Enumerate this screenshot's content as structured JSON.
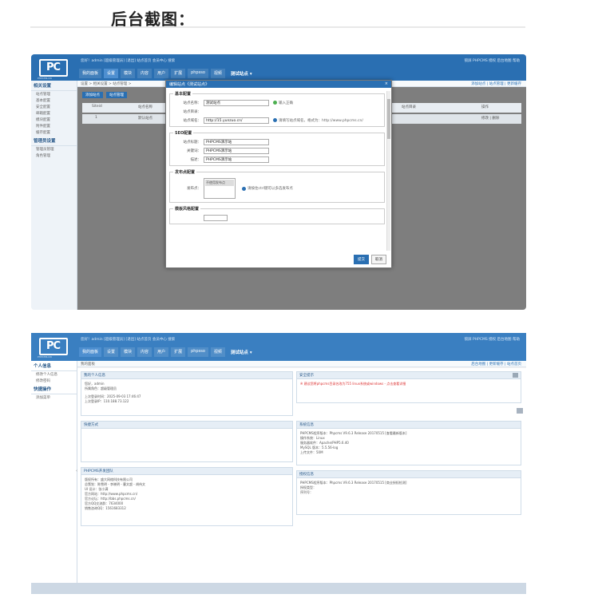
{
  "heading": "后台截图：",
  "shot1": {
    "logo": "PC",
    "logo_sub": "PHPCMS.CN",
    "userbar": "您好！admin [超级管理员] [退出] 站点首页 会员中心 搜索",
    "rlinks": "锁屏 PHPCMS 授权 后台地图 帮助",
    "nav": [
      "我的面板",
      "设置",
      "模块",
      "内容",
      "用户",
      "扩展",
      "phpsso",
      "视频",
      "测试站点 ▾"
    ],
    "sidebar": {
      "group1": "相关设置",
      "items1": [
        "站点管理",
        "基本配置",
        "安全配置",
        "邮箱配置",
        "模块配置",
        "附件配置",
        "缓存配置"
      ],
      "group2": "管理员设置",
      "items2": [
        "管理员管理",
        "角色管理"
      ]
    },
    "crumb": "设置 > 相关设置 > 站点管理 >",
    "crumb_right": "添加站点 | 站点管理 | 更新缓存",
    "buttons": [
      "添加站点",
      "站点管理"
    ],
    "table_cols": [
      "Siteid",
      "站点名称",
      "站点目录",
      "操作"
    ],
    "table_row": [
      "1",
      "默认站点",
      "",
      "修改 | 删除"
    ],
    "modal": {
      "title": "编辑站点《测试站点》",
      "close": "×",
      "basic_legend": "基本配置",
      "site_name_label": "站点名称：",
      "site_name_value": "测试站点",
      "site_name_tip": "输入正确",
      "site_dir_label": "站点目录：",
      "site_domain_label": "站点域名：",
      "site_domain_value": "http://15.yunzuo.cn/",
      "site_domain_tip": "请填写站点域名，格式为：http://www.phpcms.cn/",
      "seo_legend": "SEO配置",
      "seo_title_label": "站点标题：",
      "seo_title_value": "PHPCMS演示站",
      "seo_kw_label": "关键词：",
      "seo_kw_value": "PHPCMS演示站",
      "seo_desc_label": "描述：",
      "seo_desc_value": "PHPCMS演示站",
      "release_legend": "发布点配置",
      "release_label": "发布点：",
      "release_option": "不使用发布点",
      "release_tip": "请按住ctrl键可以多选发布点",
      "template_legend": "模板风格配置",
      "ok": "提交",
      "cancel": "取消"
    }
  },
  "shot2": {
    "logo": "PC",
    "logo_sub": "PHPCMS.CN",
    "userbar": "您好！admin [超级管理员] [退出] 站点首页 会员中心 搜索",
    "rlinks": "锁屏 PHPCMS 授权 后台地图 帮助",
    "nav": [
      "我的面板",
      "设置",
      "模块",
      "内容",
      "用户",
      "扩展",
      "phpsso",
      "视频",
      "测试站点 ▾"
    ],
    "sidebar": {
      "group1": "个人信息",
      "items1": [
        "修改个人信息",
        "修改密码"
      ],
      "group2": "快捷操作",
      "items2": [
        "添加菜单"
      ]
    },
    "crumb": "我的面板",
    "crumb_right": "后台地图 | 更新缓存 | 站点首页",
    "panels": {
      "personal_title": "我的个人信息",
      "personal_lines": [
        "您好，admin",
        "所属角色：超级管理员",
        "上次登录时间：2025-09-03 17:46:47",
        "上次登录IP：110.188.73.122"
      ],
      "security_title": "安全提示",
      "security_line": "※ 建议您将phpcms目录名改为755 linux系统或windows - 点击查看详细",
      "shortcut_title": "快捷方式",
      "sysinfo_title": "系统信息",
      "sysinfo_lines": [
        "PHPCMS程序版本：Phpcms V9.6.3 Release 20170515 [查看最新版本]",
        "操作系统：Linux",
        "服务器软件：Apache/PHP5.6.40",
        "MySQL 版本：5.5.56-log",
        "上传文件：50M"
      ],
      "team_title": "PHPCMS开发团队",
      "team_lines": [
        "版权所有：盛大网络科技有限公司",
        "总策划：陈雪明 - 李晓明 - 曹文超 - 胡伟文",
        "UI 设计：张小满",
        "官方网站：http://www.phpcms.cn/",
        "官方论坛：http://bbs.phpcms.cn/",
        "官方QQ交流群：7634000",
        "销售咨询QQ：1561683312"
      ],
      "auth_title": "授权信息",
      "auth_lines": [
        "PHPCMS程序版本：Phpcms V9.6.3 Release 20170515 [商业授权检测]",
        "授权类型：",
        "序列号："
      ]
    }
  }
}
